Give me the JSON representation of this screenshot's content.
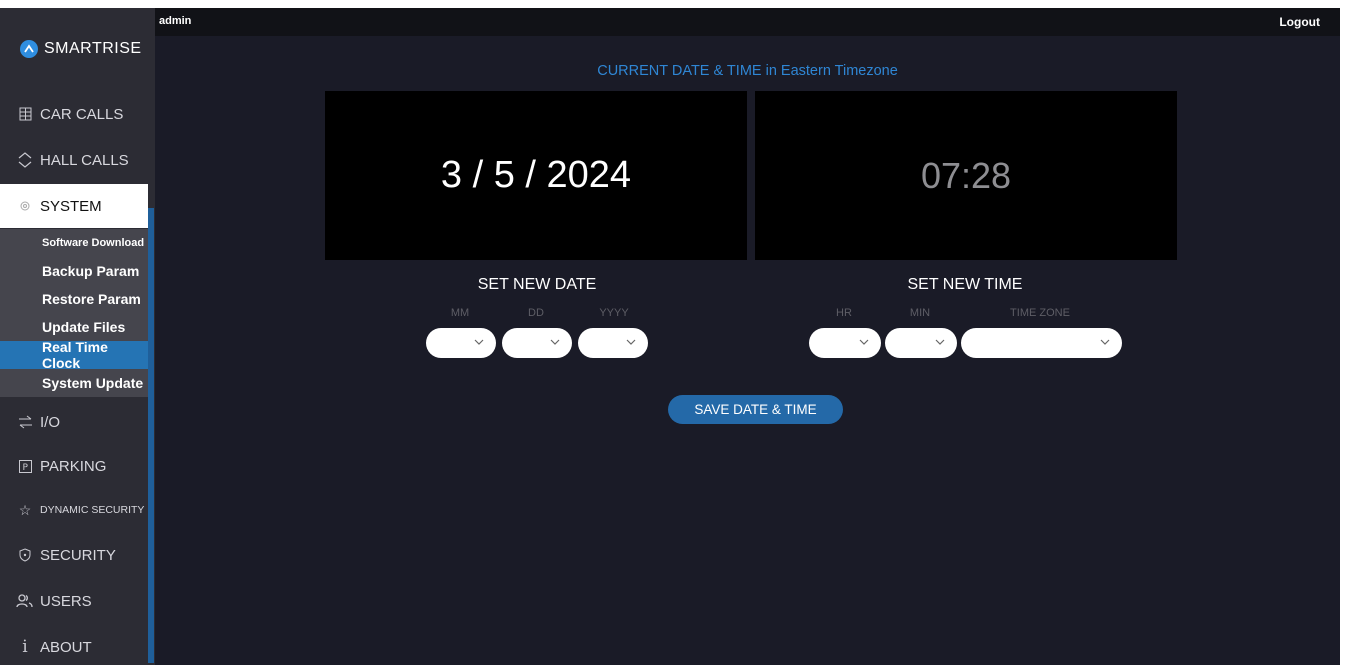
{
  "app": {
    "brand": "SMARTRISE",
    "user": "admin",
    "logout_label": "Logout"
  },
  "sidebar": {
    "items": [
      {
        "label": "CAR CALLS",
        "icon": "grid-icon"
      },
      {
        "label": "HALL CALLS",
        "icon": "chevron-updown-icon"
      },
      {
        "label": "SYSTEM",
        "icon": "gear-icon"
      },
      {
        "label": "I/O",
        "icon": "arrows-exchange-icon"
      },
      {
        "label": "PARKING",
        "icon": "parking-icon"
      },
      {
        "label": "DYNAMIC SECURITY",
        "icon": "star-icon"
      },
      {
        "label": "SECURITY",
        "icon": "shield-icon"
      },
      {
        "label": "USERS",
        "icon": "users-icon"
      },
      {
        "label": "ABOUT",
        "icon": "info-icon"
      }
    ],
    "system_sub": [
      "Software Download",
      "Backup Param",
      "Restore Param",
      "Update Files",
      "Real Time Clock",
      "System Update"
    ],
    "active_item": "SYSTEM",
    "active_sub": "Real Time Clock"
  },
  "main": {
    "heading": "CURRENT DATE & TIME in Eastern Timezone",
    "current_date": "3 / 5 / 2024",
    "current_time": "07:28",
    "set_date": {
      "title": "SET NEW DATE",
      "labels": [
        "MM",
        "DD",
        "YYYY"
      ],
      "values": [
        "",
        "",
        ""
      ]
    },
    "set_time": {
      "title": "SET NEW TIME",
      "labels": [
        "HR",
        "MIN",
        "TIME ZONE"
      ],
      "values": [
        "",
        "",
        ""
      ]
    },
    "save_label": "SAVE DATE & TIME"
  },
  "colors": {
    "accent": "#2f86d4",
    "active_sub": "#2574b4",
    "background": "#1a1b27"
  }
}
